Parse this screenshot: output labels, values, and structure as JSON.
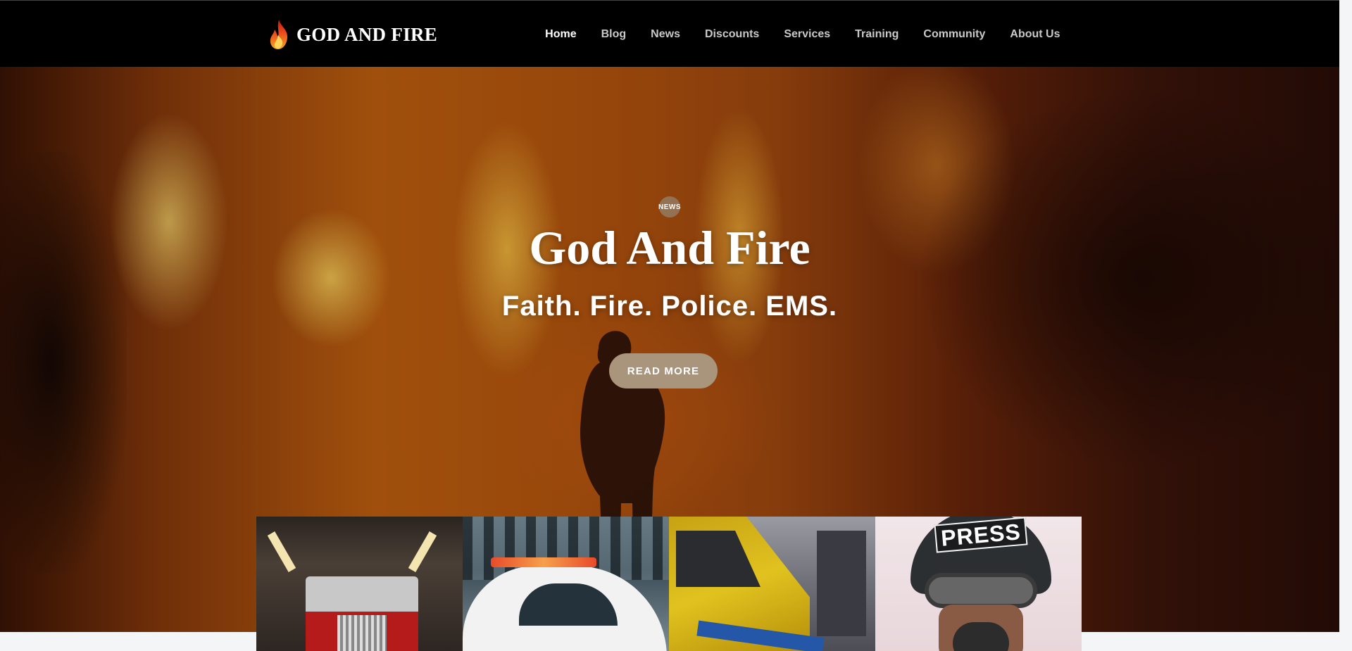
{
  "header": {
    "logo_text": "GOD AND FIRE",
    "nav": [
      "Home",
      "Blog",
      "News",
      "Discounts",
      "Services",
      "Training",
      "Community",
      "About Us"
    ],
    "active_nav": "Home"
  },
  "hero": {
    "badge": "NEWS",
    "title": "God And Fire",
    "subtitle": "Faith. Fire. Police. EMS.",
    "button": "READ MORE"
  },
  "cards": {
    "press_label": "PRESS"
  },
  "colors": {
    "header_bg": "#000000",
    "button_bg": "#a9957c",
    "active_nav": "#ffffff",
    "nav": "#c9c9c9"
  }
}
